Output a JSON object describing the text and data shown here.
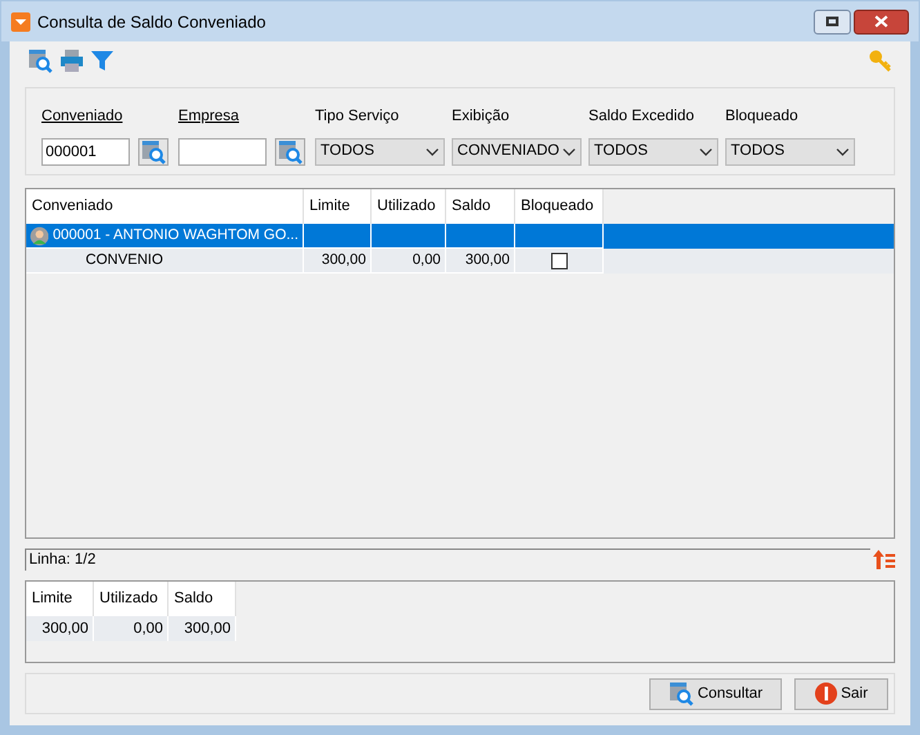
{
  "window": {
    "title": "Consulta de Saldo Conveniado"
  },
  "filters": [
    {
      "label": "Conveniado",
      "underlined": true,
      "kind": "lookup",
      "value": "000001"
    },
    {
      "label": "Empresa",
      "underlined": true,
      "kind": "lookup"
    },
    {
      "label": "Tipo Serviço",
      "underlined": false,
      "kind": "select",
      "value": "TODOS"
    },
    {
      "label": "Exibição",
      "underlined": false,
      "kind": "select",
      "value": "CONVENIADO"
    },
    {
      "label": "Saldo Excedido",
      "underlined": false,
      "kind": "select",
      "value": "TODOS"
    },
    {
      "label": "Bloqueado",
      "underlined": false,
      "kind": "select",
      "value": "TODOS"
    }
  ],
  "grid": {
    "columns": [
      "Conveniado",
      "Limite",
      "Utilizado",
      "Saldo",
      "Bloqueado"
    ],
    "rows": [
      {
        "kind": "group",
        "selected": true,
        "cells": [
          "000001 - ANTONIO WAGHTOM GO..."
        ]
      },
      {
        "kind": "detail",
        "selected": false,
        "cells": [
          "CONVENIO",
          "300,00",
          "0,00",
          "300,00"
        ],
        "checked": false
      }
    ]
  },
  "status": "Linha: 1/2",
  "totals": {
    "columns": [
      "Limite",
      "Utilizado",
      "Saldo"
    ],
    "values": [
      "300,00",
      "0,00",
      "300,00"
    ]
  },
  "buttons": [
    {
      "kind": "search",
      "label": "Consultar"
    },
    {
      "kind": "exit",
      "label": "Sair"
    }
  ]
}
